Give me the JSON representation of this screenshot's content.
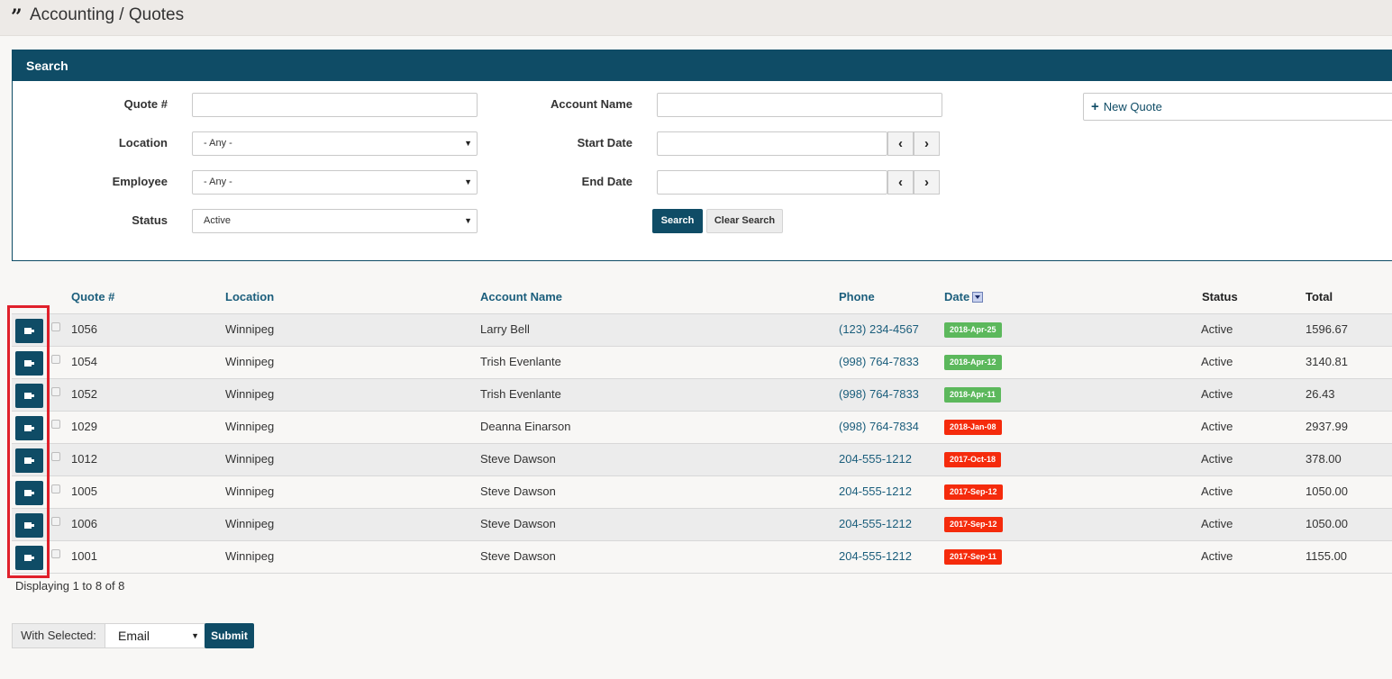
{
  "breadcrumb": {
    "icon": "quote-icon",
    "text": "Accounting / Quotes"
  },
  "search": {
    "title": "Search",
    "quote_label": "Quote #",
    "quote_value": "",
    "account_label": "Account Name",
    "account_value": "",
    "location_label": "Location",
    "location_value": "- Any -",
    "employee_label": "Employee",
    "employee_value": "- Any -",
    "status_label": "Status",
    "status_value": "Active",
    "start_label": "Start Date",
    "start_value": "",
    "end_label": "End Date",
    "end_value": "",
    "search_button": "Search",
    "clear_button": "Clear Search",
    "new_quote_button": "New Quote"
  },
  "table": {
    "headers": {
      "quote": "Quote #",
      "location": "Location",
      "account": "Account Name",
      "phone": "Phone",
      "date": "Date",
      "status": "Status",
      "total": "Total"
    },
    "rows": [
      {
        "quote": "1056",
        "location": "Winnipeg",
        "account": "Larry Bell",
        "phone": "(123) 234-4567",
        "date": "2018-Apr-25",
        "date_color": "#5cb85c",
        "status": "Active",
        "total": "1596.67"
      },
      {
        "quote": "1054",
        "location": "Winnipeg",
        "account": "Trish Evenlante",
        "phone": "(998) 764-7833",
        "date": "2018-Apr-12",
        "date_color": "#5cb85c",
        "status": "Active",
        "total": "3140.81"
      },
      {
        "quote": "1052",
        "location": "Winnipeg",
        "account": "Trish Evenlante",
        "phone": "(998) 764-7833",
        "date": "2018-Apr-11",
        "date_color": "#5cb85c",
        "status": "Active",
        "total": "26.43"
      },
      {
        "quote": "1029",
        "location": "Winnipeg",
        "account": "Deanna Einarson",
        "phone": "(998) 764-7834",
        "date": "2018-Jan-08",
        "date_color": "#f52b0c",
        "status": "Active",
        "total": "2937.99"
      },
      {
        "quote": "1012",
        "location": "Winnipeg",
        "account": "Steve Dawson",
        "phone": "204-555-1212",
        "date": "2017-Oct-18",
        "date_color": "#f52b0c",
        "status": "Active",
        "total": "378.00"
      },
      {
        "quote": "1005",
        "location": "Winnipeg",
        "account": "Steve Dawson",
        "phone": "204-555-1212",
        "date": "2017-Sep-12",
        "date_color": "#f52b0c",
        "status": "Active",
        "total": "1050.00"
      },
      {
        "quote": "1006",
        "location": "Winnipeg",
        "account": "Steve Dawson",
        "phone": "204-555-1212",
        "date": "2017-Sep-12",
        "date_color": "#f52b0c",
        "status": "Active",
        "total": "1050.00"
      },
      {
        "quote": "1001",
        "location": "Winnipeg",
        "account": "Steve Dawson",
        "phone": "204-555-1212",
        "date": "2017-Sep-11",
        "date_color": "#f52b0c",
        "status": "Active",
        "total": "1155.00"
      }
    ],
    "displaying": "Displaying 1 to 8 of 8"
  },
  "bulk": {
    "label": "With Selected:",
    "action_value": "Email",
    "submit": "Submit"
  }
}
